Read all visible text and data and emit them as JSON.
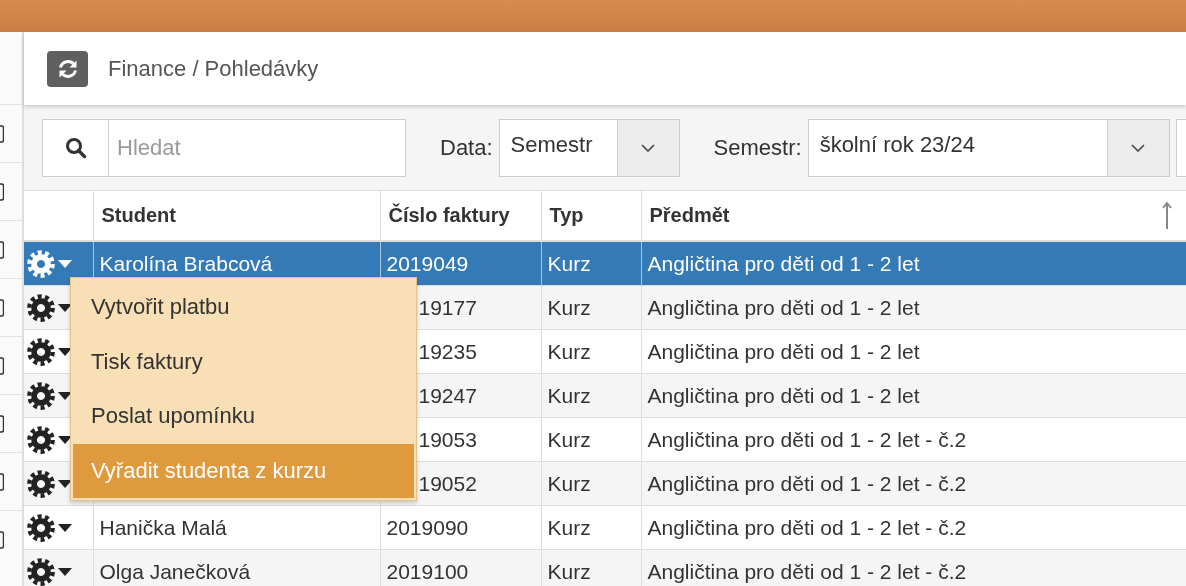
{
  "breadcrumb": "Finance / Pohledávky",
  "search": {
    "placeholder": "Hledat"
  },
  "filters": [
    {
      "label": "Data:",
      "value": "Semestr"
    },
    {
      "label": "Semestr:",
      "value": "školní rok 23/24"
    }
  ],
  "table": {
    "columns": [
      {
        "label": "Student",
        "sorted": false
      },
      {
        "label": "Číslo faktury",
        "sorted": false
      },
      {
        "label": "Typ",
        "sorted": false
      },
      {
        "label": "Předmět",
        "sorted": true
      }
    ],
    "rows": [
      {
        "student": "Karolína Brabcová",
        "invoice": "2019049",
        "type": "Kurz",
        "subject": "Angličtina pro děti od 1 - 2 let",
        "selected": true
      },
      {
        "invoice": "19177",
        "type": "Kurz",
        "subject": "Angličtina pro děti od 1 - 2 let",
        "selected": false
      },
      {
        "invoice": "19235",
        "type": "Kurz",
        "subject": "Angličtina pro děti od 1 - 2 let",
        "selected": false
      },
      {
        "invoice": "19247",
        "type": "Kurz",
        "subject": "Angličtina pro děti od 1 - 2 let",
        "selected": false
      },
      {
        "invoice": "19053",
        "type": "Kurz",
        "subject": "Angličtina pro děti od 1 - 2 let - č.2",
        "selected": false
      },
      {
        "invoice": "19052",
        "type": "Kurz",
        "subject": "Angličtina pro děti od 1 - 2 let - č.2",
        "selected": false
      },
      {
        "student": "Hanička Malá",
        "invoice": "2019090",
        "type": "Kurz",
        "subject": "Angličtina pro děti od 1 - 2 let - č.2",
        "selected": false
      },
      {
        "student": "Olga Janečková",
        "invoice": "2019100",
        "type": "Kurz",
        "subject": "Angličtina pro děti od 1 - 2 let - č.2",
        "selected": false
      }
    ]
  },
  "context_menu": {
    "items": [
      {
        "label": "Vytvořit platbu",
        "selected": false
      },
      {
        "label": "Tisk faktury",
        "selected": false
      },
      {
        "label": "Poslat upomínku",
        "selected": false
      },
      {
        "label": "Vyřadit studenta z kurzu",
        "selected": true
      }
    ]
  }
}
